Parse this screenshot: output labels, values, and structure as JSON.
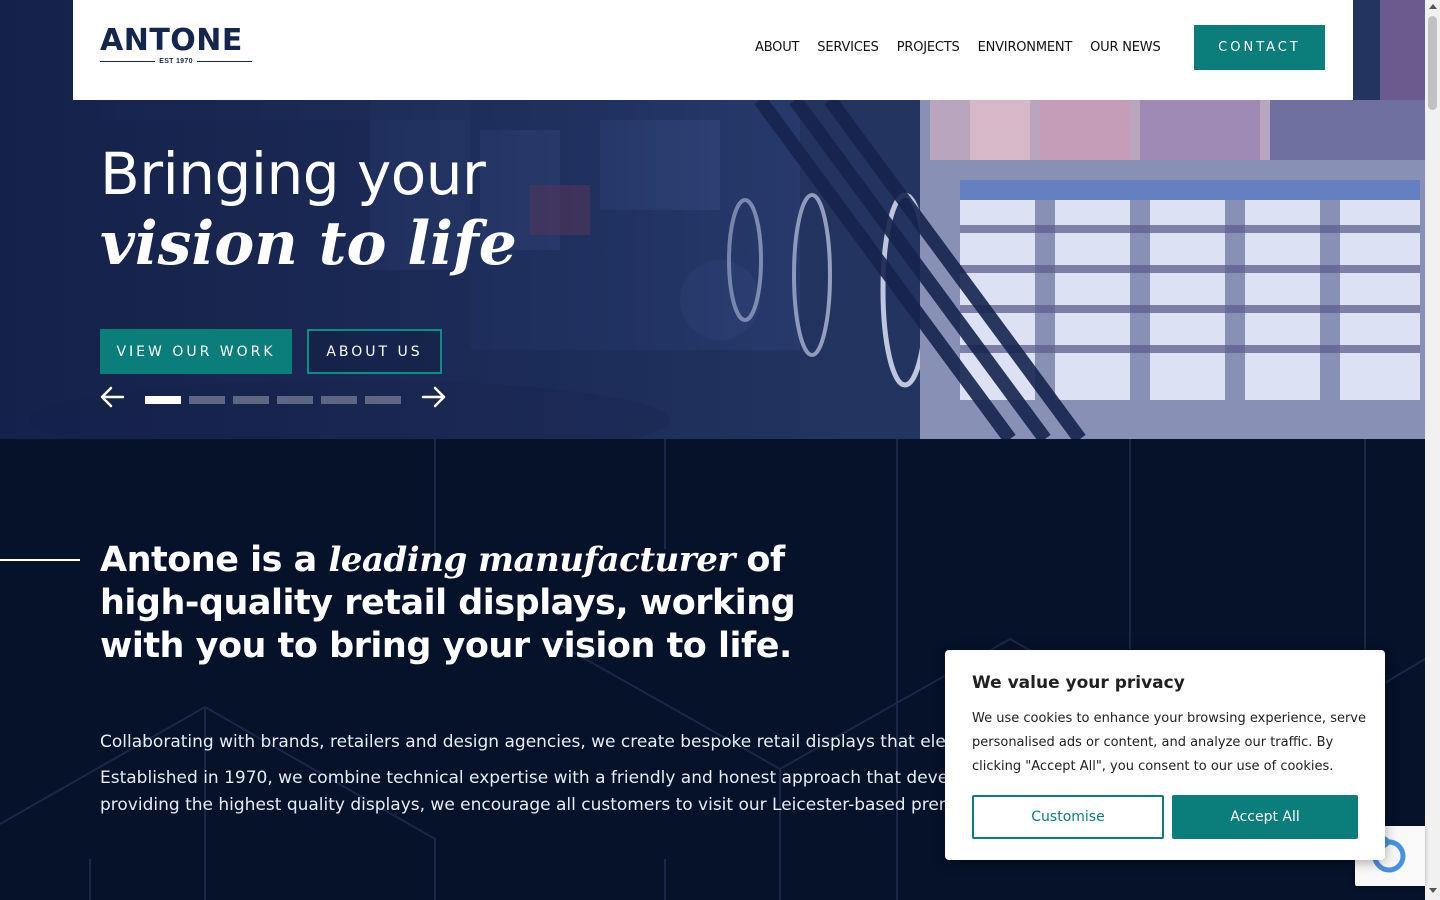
{
  "header": {
    "logo": {
      "name": "ANTONE",
      "tagline": "EST 1970"
    },
    "nav": [
      "ABOUT",
      "SERVICES",
      "PROJECTS",
      "ENVIRONMENT",
      "OUR NEWS"
    ],
    "contact_label": "CONTACT"
  },
  "hero": {
    "title_line1": "Bringing your",
    "title_line2": "vision to life",
    "btn_work": "VIEW OUR WORK",
    "btn_about": "ABOUT US",
    "slide_count": 6,
    "active_slide": 1
  },
  "about": {
    "heading_pre": "Antone is a ",
    "heading_em": "leading manufacturer",
    "heading_post": " of high-quality retail displays, working with you to bring your vision to life.",
    "p1": "Collaborating with brands, retailers and design agencies, we create bespoke retail displays that elevate",
    "p2_l1": "Established in 1970, we combine technical expertise with a friendly and honest approach that develops",
    "p2_l2": "providing the highest quality displays, we encourage all customers to visit our Leicester-based premises"
  },
  "cookie": {
    "title": "We value your privacy",
    "text": "We use cookies to enhance your browsing experience, serve personalised ads or content, and analyze our traffic. By clicking \"Accept All\", you consent to our use of cookies.",
    "customise": "Customise",
    "accept": "Accept All"
  },
  "colors": {
    "navy": "#06112a",
    "teal": "#0b7d7a",
    "logo": "#14254e"
  }
}
